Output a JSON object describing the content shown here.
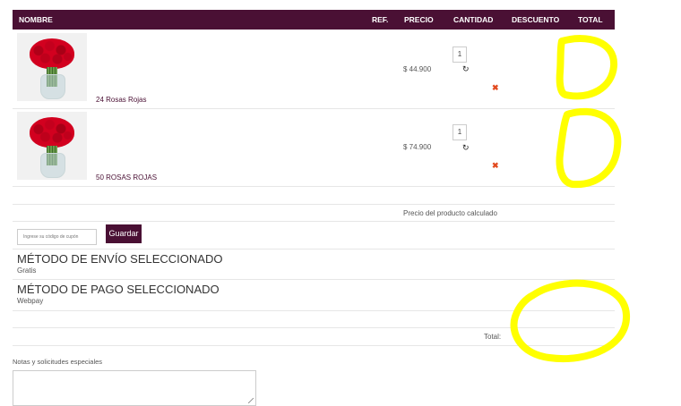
{
  "table": {
    "headers": {
      "name": "NOMBRE",
      "ref": "REF.",
      "price": "PRECIO",
      "qty": "CANTIDAD",
      "discount": "DESCUENTO",
      "total": "TOTAL"
    },
    "rows": [
      {
        "name": "24 Rosas Rojas",
        "price": "$ 44.900",
        "qty": "1"
      },
      {
        "name": "50 ROSAS ROJAS",
        "price": "$ 74.900",
        "qty": "1"
      }
    ]
  },
  "summary": {
    "price_note": "Precio del producto calculado"
  },
  "coupon": {
    "placeholder": "Ingrese su código de cupón",
    "button": "Guardar"
  },
  "shipping": {
    "title": "MÉTODO DE ENVÍO SELECCIONADO",
    "value": "Gratis"
  },
  "payment": {
    "title": "MÉTODO DE PAGO SELECCIONADO",
    "value": "Webpay"
  },
  "total": {
    "label": "Total:"
  },
  "notes": {
    "label": "Notas y solicitudes especiales"
  },
  "icons": {
    "refresh": "refresh-icon",
    "remove": "remove-icon"
  },
  "colors": {
    "brand": "#4a1034",
    "remove": "#e24a1f",
    "highlight": "#ffff00"
  }
}
